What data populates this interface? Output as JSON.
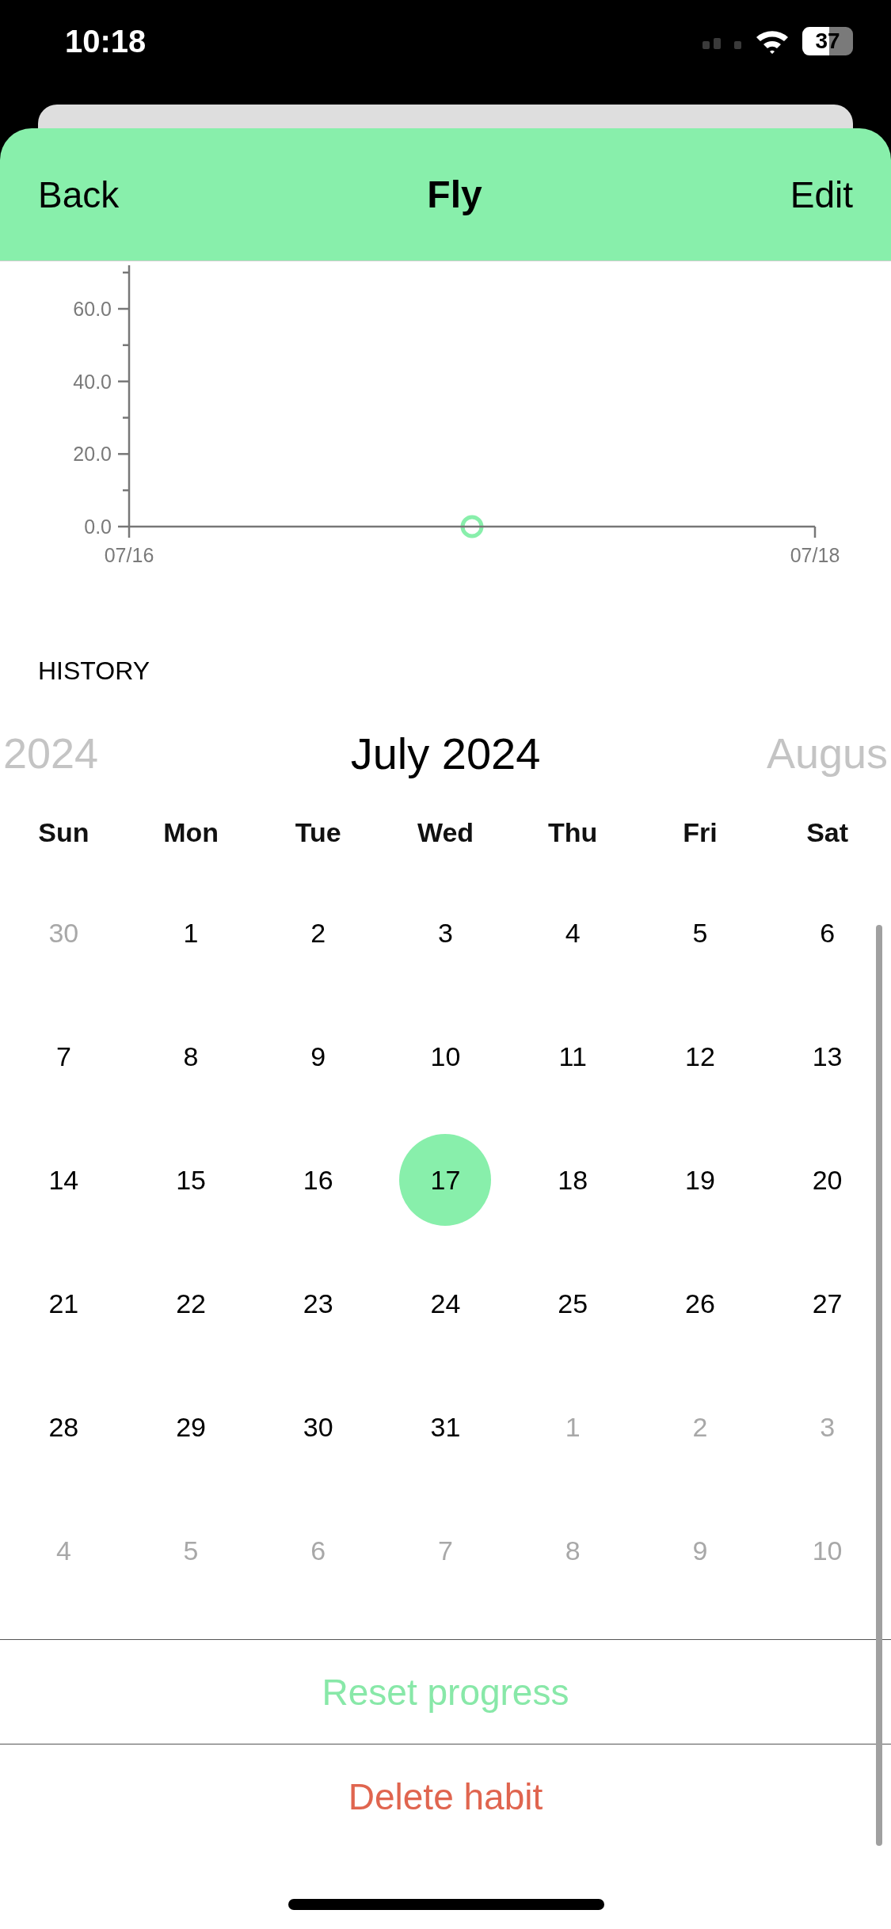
{
  "status_bar": {
    "time": "10:18",
    "battery": "37"
  },
  "nav": {
    "back": "Back",
    "title": "Fly",
    "edit": "Edit"
  },
  "chart": {
    "chart_data": {
      "type": "scatter",
      "categories": [
        "07/16",
        null,
        "07/18"
      ],
      "series": [
        {
          "color": "#88efab",
          "values": [
            null,
            0,
            null
          ]
        }
      ],
      "ylim": [
        0,
        72
      ],
      "yticks": [
        {
          "value": 0,
          "label": "0.0"
        },
        {
          "value": 20,
          "label": "20.0"
        },
        {
          "value": 40,
          "label": "40.0"
        },
        {
          "value": 60,
          "label": "60.0"
        }
      ]
    }
  },
  "history": {
    "heading": "HISTORY"
  },
  "calendar": {
    "previous": "2024",
    "month": "July 2024",
    "next": "Augus",
    "weekdays": [
      "Sun",
      "Mon",
      "Tue",
      "Wed",
      "Thu",
      "Fri",
      "Sat"
    ],
    "weeks": [
      [
        {
          "label": "30",
          "muted": true,
          "selected": false
        },
        {
          "label": "1",
          "muted": false,
          "selected": false
        },
        {
          "label": "2",
          "muted": false,
          "selected": false
        },
        {
          "label": "3",
          "muted": false,
          "selected": false
        },
        {
          "label": "4",
          "muted": false,
          "selected": false
        },
        {
          "label": "5",
          "muted": false,
          "selected": false
        },
        {
          "label": "6",
          "muted": false,
          "selected": false
        }
      ],
      [
        {
          "label": "7",
          "muted": false,
          "selected": false
        },
        {
          "label": "8",
          "muted": false,
          "selected": false
        },
        {
          "label": "9",
          "muted": false,
          "selected": false
        },
        {
          "label": "10",
          "muted": false,
          "selected": false
        },
        {
          "label": "11",
          "muted": false,
          "selected": false
        },
        {
          "label": "12",
          "muted": false,
          "selected": false
        },
        {
          "label": "13",
          "muted": false,
          "selected": false
        }
      ],
      [
        {
          "label": "14",
          "muted": false,
          "selected": false
        },
        {
          "label": "15",
          "muted": false,
          "selected": false
        },
        {
          "label": "16",
          "muted": false,
          "selected": false
        },
        {
          "label": "17",
          "muted": false,
          "selected": true
        },
        {
          "label": "18",
          "muted": false,
          "selected": false
        },
        {
          "label": "19",
          "muted": false,
          "selected": false
        },
        {
          "label": "20",
          "muted": false,
          "selected": false
        }
      ],
      [
        {
          "label": "21",
          "muted": false,
          "selected": false
        },
        {
          "label": "22",
          "muted": false,
          "selected": false
        },
        {
          "label": "23",
          "muted": false,
          "selected": false
        },
        {
          "label": "24",
          "muted": false,
          "selected": false
        },
        {
          "label": "25",
          "muted": false,
          "selected": false
        },
        {
          "label": "26",
          "muted": false,
          "selected": false
        },
        {
          "label": "27",
          "muted": false,
          "selected": false
        }
      ],
      [
        {
          "label": "28",
          "muted": false,
          "selected": false
        },
        {
          "label": "29",
          "muted": false,
          "selected": false
        },
        {
          "label": "30",
          "muted": false,
          "selected": false
        },
        {
          "label": "31",
          "muted": false,
          "selected": false
        },
        {
          "label": "1",
          "muted": true,
          "selected": false
        },
        {
          "label": "2",
          "muted": true,
          "selected": false
        },
        {
          "label": "3",
          "muted": true,
          "selected": false
        }
      ],
      [
        {
          "label": "4",
          "muted": true,
          "selected": false
        },
        {
          "label": "5",
          "muted": true,
          "selected": false
        },
        {
          "label": "6",
          "muted": true,
          "selected": false
        },
        {
          "label": "7",
          "muted": true,
          "selected": false
        },
        {
          "label": "8",
          "muted": true,
          "selected": false
        },
        {
          "label": "9",
          "muted": true,
          "selected": false
        },
        {
          "label": "10",
          "muted": true,
          "selected": false
        }
      ]
    ]
  },
  "actions": [
    {
      "label": "Reset progress",
      "kind": "neutral"
    },
    {
      "label": "Delete habit",
      "kind": "destructive"
    }
  ]
}
